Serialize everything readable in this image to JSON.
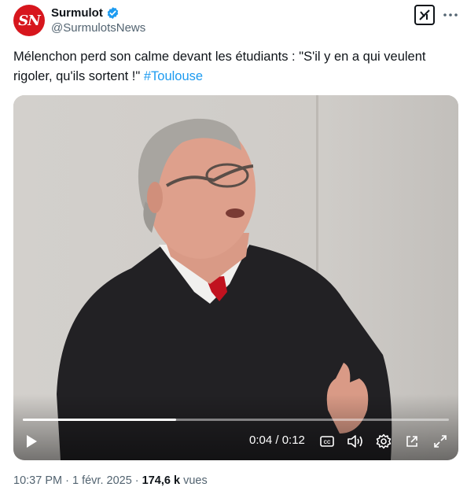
{
  "author": {
    "avatar_text": "SN",
    "name": "Surmulot",
    "handle": "@SurmulotsNews",
    "verified": true
  },
  "tweet": {
    "text": "Mélenchon perd son calme devant les étudiants : \"S'il y en a qui veulent rigoler, qu'ils sortent !\"",
    "hashtag": "#Toulouse"
  },
  "video": {
    "time_display": "0:04 / 0:12",
    "progress_fraction": 0.36,
    "controls": [
      "play-icon",
      "captions-icon",
      "volume-icon",
      "settings-icon",
      "popout-icon",
      "fullscreen-icon"
    ]
  },
  "meta": {
    "time": "10:37 PM",
    "separator1": "·",
    "date": "1 févr. 2025",
    "separator2": "·",
    "views_count": "174,6 k",
    "views_label": "vues"
  },
  "colors": {
    "brand": "#d7161d",
    "verified": "#1d9bf0",
    "link": "#1d9bf0",
    "secondary_text": "#536471"
  }
}
